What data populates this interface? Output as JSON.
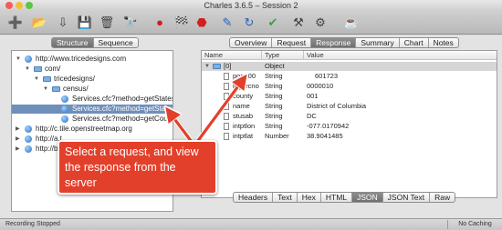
{
  "window": {
    "title": "Charles 3.6.5 – Session 2"
  },
  "toolbar": {
    "buttons": [
      {
        "name": "new-session",
        "glyph": "➕",
        "color": "#3a8e2f"
      },
      {
        "name": "open-folder",
        "glyph": "📂",
        "color": "#5a8fd1"
      },
      {
        "name": "import",
        "glyph": "⇩",
        "color": "#444"
      },
      {
        "name": "save",
        "glyph": "💾",
        "color": "#333"
      },
      {
        "name": "clear",
        "glyph": "🗑",
        "color": "#444"
      },
      {
        "name": "find",
        "glyph": "🔭",
        "color": "#222"
      },
      {
        "name": "record",
        "glyph": "●",
        "color": "#d21d1d"
      },
      {
        "name": "throttle",
        "glyph": "🏁",
        "color": "#222"
      },
      {
        "name": "breakpoints",
        "glyph": "⬣",
        "color": "#d02020"
      },
      {
        "name": "compose",
        "glyph": "✎",
        "color": "#2a63b8"
      },
      {
        "name": "repeat",
        "glyph": "↻",
        "color": "#2a63b8"
      },
      {
        "name": "validate",
        "glyph": "✔",
        "color": "#3aa23a"
      },
      {
        "name": "tools",
        "glyph": "⚒",
        "color": "#444"
      },
      {
        "name": "settings",
        "glyph": "⚙",
        "color": "#444"
      },
      {
        "name": "donate",
        "glyph": "☕",
        "color": "#5a6fb0"
      }
    ]
  },
  "left": {
    "tabs": [
      {
        "label": "Structure",
        "active": true
      },
      {
        "label": "Sequence",
        "active": false
      }
    ],
    "tree": [
      {
        "label": "http://www.tricedesigns.com",
        "icon": "globe",
        "expanded": true,
        "indent": 0
      },
      {
        "label": "com/",
        "icon": "folder",
        "expanded": true,
        "indent": 1
      },
      {
        "label": "tricedesigns/",
        "icon": "folder",
        "expanded": true,
        "indent": 2
      },
      {
        "label": "census/",
        "icon": "folder",
        "expanded": true,
        "indent": 3
      },
      {
        "label": "Services.cfc?method=getStates",
        "icon": "request",
        "indent": 4
      },
      {
        "label": "Services.cfc?method=getStates",
        "icon": "request",
        "indent": 4,
        "selected": true
      },
      {
        "label": "Services.cfc?method=getCounty",
        "icon": "request",
        "indent": 4
      },
      {
        "label": "http://c.tile.openstreetmap.org",
        "icon": "globe",
        "expanded": false,
        "indent": 0
      },
      {
        "label": "http://a.t",
        "icon": "globe",
        "expanded": false,
        "indent": 0
      },
      {
        "label": "http://b.t",
        "icon": "globe",
        "expanded": false,
        "indent": 0
      }
    ]
  },
  "right": {
    "tabs": [
      {
        "label": "Overview",
        "active": false
      },
      {
        "label": "Request",
        "active": false
      },
      {
        "label": "Response",
        "active": true
      },
      {
        "label": "Summary",
        "active": false
      },
      {
        "label": "Chart",
        "active": false
      },
      {
        "label": "Notes",
        "active": false
      }
    ],
    "columns": [
      "Name",
      "Type",
      "Value"
    ],
    "rows": [
      {
        "name": "[0]",
        "type": "Object",
        "value": "",
        "indent": 0,
        "selected": true,
        "folder": true
      },
      {
        "name": "pop100",
        "type": "String",
        "value": "601723",
        "indent": 1
      },
      {
        "name": "logrecno",
        "type": "String",
        "value": "0000010",
        "indent": 1
      },
      {
        "name": "county",
        "type": "String",
        "value": "001",
        "indent": 1
      },
      {
        "name": "name",
        "type": "String",
        "value": "District of Columbia",
        "indent": 1
      },
      {
        "name": "stusab",
        "type": "String",
        "value": "DC",
        "indent": 1
      },
      {
        "name": "intptlon",
        "type": "String",
        "value": "-077.0170942",
        "indent": 1
      },
      {
        "name": "intptlat",
        "type": "Number",
        "value": "38.9041485",
        "indent": 1
      }
    ],
    "bottom_tabs": [
      {
        "label": "Headers",
        "active": false
      },
      {
        "label": "Text",
        "active": false
      },
      {
        "label": "Hex",
        "active": false
      },
      {
        "label": "HTML",
        "active": false
      },
      {
        "label": "JSON",
        "active": true
      },
      {
        "label": "JSON Text",
        "active": false
      },
      {
        "label": "Raw",
        "active": false
      }
    ]
  },
  "callout": {
    "text": "Select a request, and view the response from the server",
    "color": "#e2402b"
  },
  "status": {
    "left": "Recording Stopped",
    "right": "No Caching"
  }
}
